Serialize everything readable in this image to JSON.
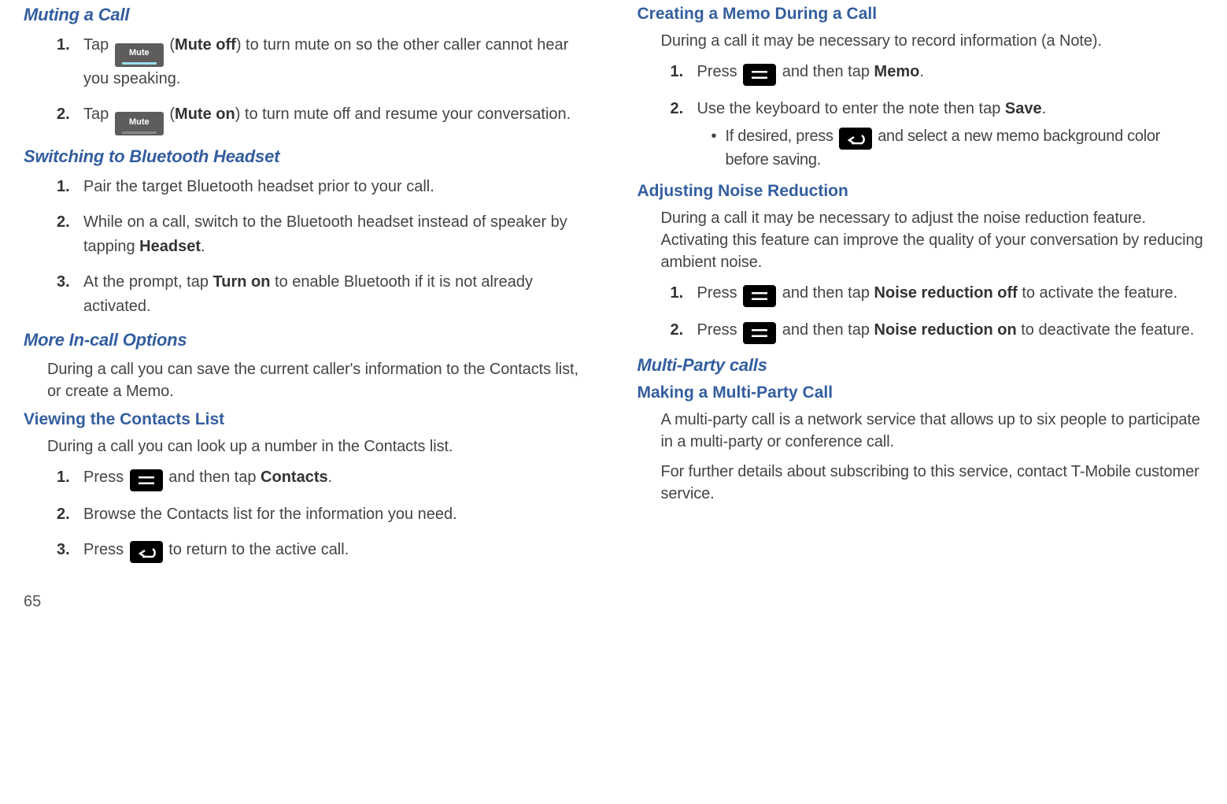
{
  "left": {
    "muting": {
      "heading": "Muting a Call",
      "steps": [
        {
          "pre": "Tap ",
          "mute_label": "Mute",
          "paren": "Mute off",
          "post": ") to turn mute on so the other caller cannot hear you speaking."
        },
        {
          "pre": "Tap ",
          "mute_label": "Mute",
          "paren": "Mute on",
          "post": ") to turn mute off and resume your conversation."
        }
      ]
    },
    "bluetooth": {
      "heading": "Switching to Bluetooth Headset",
      "steps": [
        {
          "text": "Pair the target Bluetooth headset prior to your call."
        },
        {
          "pre": "While on a call, switch to the Bluetooth headset instead of speaker by tapping ",
          "bold": "Headset",
          "post": "."
        },
        {
          "pre": "At the prompt, tap ",
          "bold": "Turn on",
          "post": " to enable Bluetooth if it is not already activated."
        }
      ]
    },
    "more": {
      "heading": "More In-call Options",
      "para": "During a call you can save the current caller's information to the Contacts list, or create a Memo."
    },
    "contacts": {
      "heading": "Viewing the Contacts List",
      "para": "During a call you can look up a number in the Contacts list.",
      "steps": [
        {
          "pre": "Press ",
          "icon": "menu",
          "mid": " and then tap ",
          "bold": "Contacts",
          "post": "."
        },
        {
          "text": "Browse the Contacts list for the information you need."
        },
        {
          "pre": "Press ",
          "icon": "back",
          "post": " to return to the active call."
        }
      ]
    }
  },
  "right": {
    "memo": {
      "heading": "Creating a Memo During a Call",
      "para": "During a call it may be necessary to record information (a Note).",
      "steps": [
        {
          "pre": "Press ",
          "icon": "menu",
          "mid": " and then tap ",
          "bold": "Memo",
          "post": "."
        },
        {
          "pre": "Use the keyboard to enter the note then tap ",
          "bold": "Save",
          "post": ".",
          "bullets": [
            {
              "pre": "If desired, press ",
              "icon": "back",
              "post": " and select a new memo background color before saving."
            }
          ]
        }
      ]
    },
    "noise": {
      "heading": "Adjusting Noise Reduction",
      "para": "During a call it may be necessary to adjust the noise reduction feature. Activating this feature can improve the quality of your conversation by reducing ambient noise.",
      "steps": [
        {
          "pre": "Press ",
          "icon": "menu",
          "mid": " and then tap ",
          "bold": "Noise reduction off",
          "post": " to activate the feature."
        },
        {
          "pre": "Press ",
          "icon": "menu",
          "mid": " and then tap ",
          "bold": "Noise reduction on",
          "post": " to deactivate the feature."
        }
      ]
    },
    "multi": {
      "heading": "Multi-Party calls",
      "sub": "Making a Multi-Party Call",
      "para1": "A multi-party call is a network service that allows up to six people to participate in a multi-party or conference call.",
      "para2": "For further details about subscribing to this service, contact T-Mobile customer service."
    }
  },
  "page_number": "65"
}
